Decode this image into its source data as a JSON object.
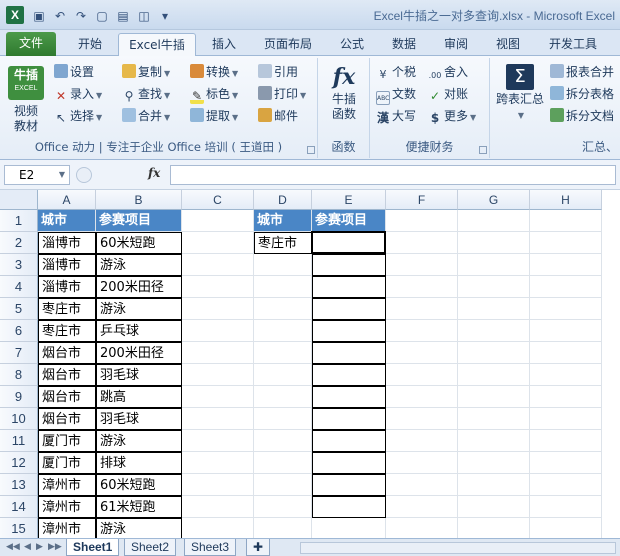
{
  "window": {
    "title": "Excel牛插之一对多查询.xlsx - Microsoft Excel",
    "logo_letter": "X"
  },
  "tabs": [
    {
      "label": "文件"
    },
    {
      "label": "开始"
    },
    {
      "label": "Excel牛插"
    },
    {
      "label": "插入"
    },
    {
      "label": "页面布局"
    },
    {
      "label": "公式"
    },
    {
      "label": "数据"
    },
    {
      "label": "审阅"
    },
    {
      "label": "视图"
    },
    {
      "label": "开发工具"
    }
  ],
  "ribbon": {
    "logo_text": "牛插",
    "logo_sub": "EXCEL",
    "video_label": "视频",
    "tutorial_label": "教材",
    "group1": {
      "col1": [
        "设置",
        "录入",
        "选择"
      ],
      "col2": [
        "复制",
        "查找",
        "合并"
      ],
      "col3": [
        "转换",
        "标色",
        "提取"
      ],
      "col4": [
        "引用",
        "打印",
        "邮件"
      ],
      "label": "Office 动力 | 专注于企业 Office 培训 ( 王道田 )"
    },
    "group2": {
      "big_line1": "牛插",
      "big_line2": "函数",
      "label": "函数"
    },
    "group3": {
      "items": [
        "个税",
        "舍入",
        "文数",
        "对账",
        "大写",
        "更多"
      ],
      "icons": [
        "¥",
        ".00",
        "ABC",
        "✓",
        "漢",
        "$"
      ],
      "label": "便捷财务"
    },
    "group4": {
      "big_label": "跨表汇总",
      "items": [
        "报表合并",
        "拆分表格",
        "拆分文档"
      ],
      "label": "汇总、"
    }
  },
  "formula_bar": {
    "name_box": "E2",
    "fx": "fx",
    "value": ""
  },
  "columns": [
    "A",
    "B",
    "C",
    "D",
    "E",
    "F",
    "G",
    "H"
  ],
  "rows": [
    "1",
    "2",
    "3",
    "4",
    "5",
    "6",
    "7",
    "8",
    "9",
    "10",
    "11",
    "12",
    "13",
    "14",
    "15"
  ],
  "table_left": {
    "headers": [
      "城市",
      "参赛项目"
    ],
    "data": [
      [
        "淄博市",
        "60米短跑"
      ],
      [
        "淄博市",
        "游泳"
      ],
      [
        "淄博市",
        "200米田径"
      ],
      [
        "枣庄市",
        "游泳"
      ],
      [
        "枣庄市",
        "乒乓球"
      ],
      [
        "烟台市",
        "200米田径"
      ],
      [
        "烟台市",
        "羽毛球"
      ],
      [
        "烟台市",
        "跳高"
      ],
      [
        "烟台市",
        "羽毛球"
      ],
      [
        "厦门市",
        "游泳"
      ],
      [
        "厦门市",
        "排球"
      ],
      [
        "漳州市",
        "60米短跑"
      ],
      [
        "漳州市",
        "61米短跑"
      ],
      [
        "漳州市",
        "游泳"
      ]
    ]
  },
  "table_right": {
    "headers": [
      "城市",
      "参赛项目"
    ],
    "city": "枣庄市"
  },
  "sheets": [
    "Sheet1",
    "Sheet2",
    "Sheet3"
  ]
}
